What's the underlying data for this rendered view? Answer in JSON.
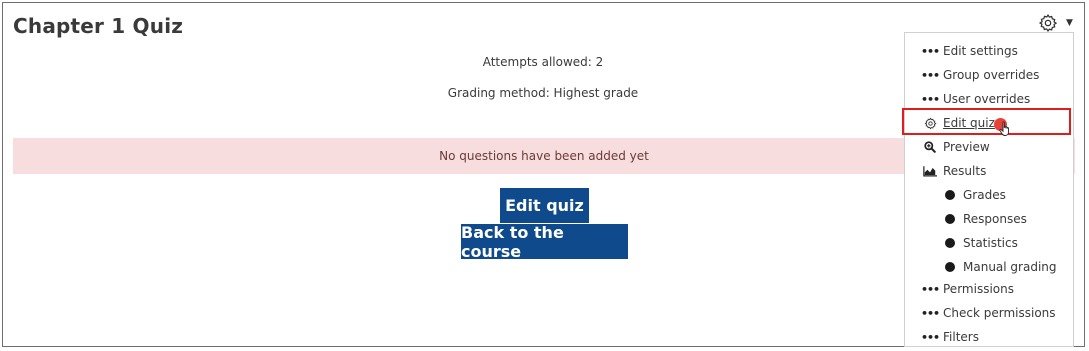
{
  "page": {
    "title": "Chapter 1 Quiz"
  },
  "quiz_info": {
    "attempts_allowed": "Attempts allowed: 2",
    "grading_method": "Grading method: Highest grade"
  },
  "notice": {
    "text": "No questions have been added yet"
  },
  "buttons": {
    "edit_quiz": "Edit quiz",
    "back_to_course": "Back to the course"
  },
  "actions_menu": {
    "items": [
      {
        "label": "Edit settings",
        "icon": "dots-icon"
      },
      {
        "label": "Group overrides",
        "icon": "dots-icon"
      },
      {
        "label": "User overrides",
        "icon": "dots-icon"
      },
      {
        "label": "Edit quiz",
        "icon": "gear-icon",
        "highlighted": true
      },
      {
        "label": "Preview",
        "icon": "magnifier-icon"
      },
      {
        "label": "Results",
        "icon": "area-chart-icon"
      },
      {
        "label": "Grades",
        "icon": "bullet-icon"
      },
      {
        "label": "Responses",
        "icon": "bullet-icon"
      },
      {
        "label": "Statistics",
        "icon": "bullet-icon"
      },
      {
        "label": "Manual grading",
        "icon": "bullet-icon"
      },
      {
        "label": "Permissions",
        "icon": "dots-icon"
      },
      {
        "label": "Check permissions",
        "icon": "dots-icon"
      },
      {
        "label": "Filters",
        "icon": "dots-icon"
      }
    ]
  },
  "colors": {
    "primary_button": "#0f4a8c",
    "notice_bg": "#f7dddd",
    "highlight_border": "#e01d1d",
    "click_indicator": "#e8413a"
  }
}
